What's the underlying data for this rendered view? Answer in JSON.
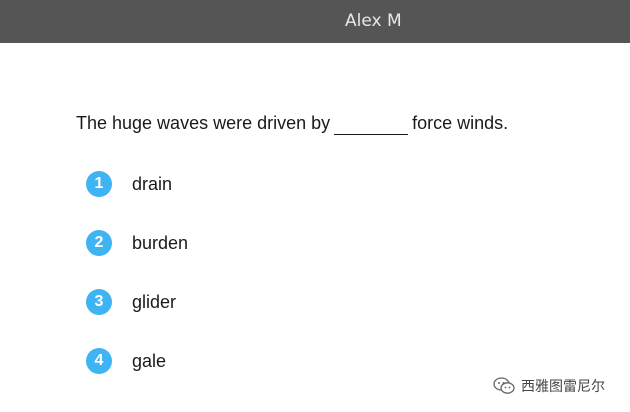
{
  "header": {
    "user_name": "Alex M"
  },
  "question": {
    "before_blank": "The huge waves were driven by",
    "after_blank": "force winds."
  },
  "options": [
    {
      "number": "1",
      "label": "drain"
    },
    {
      "number": "2",
      "label": "burden"
    },
    {
      "number": "3",
      "label": "glider"
    },
    {
      "number": "4",
      "label": "gale"
    }
  ],
  "watermark": {
    "text": "西雅图雷尼尔",
    "icon": "wechat-icon"
  },
  "colors": {
    "topbar": "#555555",
    "option_badge": "#3fb4f2"
  }
}
